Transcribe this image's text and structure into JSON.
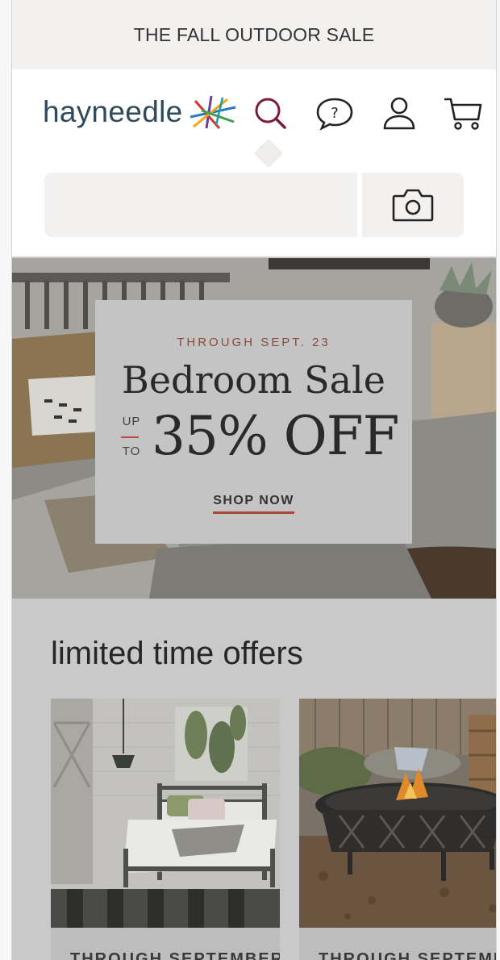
{
  "promo": {
    "text": "THE FALL OUTDOOR SALE"
  },
  "brand": {
    "name": "hayneedle"
  },
  "header": {
    "icons": [
      "search-icon",
      "help-chat-icon",
      "account-icon",
      "cart-icon"
    ],
    "search_value": "",
    "search_placeholder": ""
  },
  "hero": {
    "eyebrow": "THROUGH SEPT. 23",
    "title": "Bedroom Sale",
    "up": "UP",
    "to": "TO",
    "offer": "35% OFF",
    "cta": "SHOP NOW"
  },
  "offers": {
    "title": "limited time offers",
    "cards": [
      {
        "caption": "THROUGH SEPTEMBER"
      },
      {
        "caption": "THROUGH SEPTEMBER"
      }
    ]
  },
  "colors": {
    "accent": "#7a1d3a",
    "brand_text": "#2f4a5a",
    "promo_bg": "#f3f1ef",
    "overlay_gray": "#c9c9c9",
    "hero_accent": "#a84a3a"
  }
}
